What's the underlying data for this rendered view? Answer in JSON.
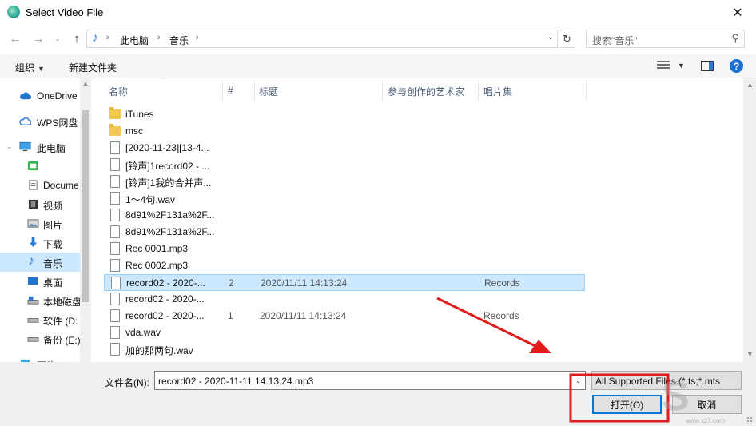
{
  "window": {
    "title": "Select Video File"
  },
  "address": {
    "crumbs": [
      "此电脑",
      "音乐"
    ],
    "search_placeholder": "搜索\"音乐\""
  },
  "toolbar": {
    "organize_label": "组织",
    "new_folder_label": "新建文件夹"
  },
  "nav": {
    "items": [
      {
        "label": "OneDrive",
        "icon": "cloud-icon"
      },
      {
        "label": "WPS网盘",
        "icon": "cloud-icon"
      },
      {
        "label": "此电脑",
        "icon": "computer-icon"
      },
      {
        "label": "",
        "icon": "app-icon"
      },
      {
        "label": "Docume",
        "icon": "documents-icon"
      },
      {
        "label": "视频",
        "icon": "video-icon"
      },
      {
        "label": "图片",
        "icon": "picture-icon"
      },
      {
        "label": "下载",
        "icon": "download-icon"
      },
      {
        "label": "音乐",
        "icon": "music-icon"
      },
      {
        "label": "桌面",
        "icon": "desktop-icon"
      },
      {
        "label": "本地磁盘",
        "icon": "drive-icon"
      },
      {
        "label": "软件 (D:",
        "icon": "drive-icon"
      },
      {
        "label": "备份 (E:)",
        "icon": "drive-icon"
      },
      {
        "label": "网络",
        "icon": "network-icon"
      }
    ]
  },
  "columns": {
    "name": "名称",
    "num": "#",
    "title": "标题",
    "artist": "参与创作的艺术家",
    "album": "唱片集"
  },
  "files": [
    {
      "name": "iTunes",
      "type": "folder",
      "num": "",
      "title": "",
      "album": ""
    },
    {
      "name": "msc",
      "type": "folder",
      "num": "",
      "title": "",
      "album": ""
    },
    {
      "name": "[2020-11-23][13-4...",
      "type": "file",
      "num": "",
      "title": "",
      "album": ""
    },
    {
      "name": "[铃声]1record02 - ...",
      "type": "file",
      "num": "",
      "title": "",
      "album": ""
    },
    {
      "name": "[铃声]1我的合并声...",
      "type": "file",
      "num": "",
      "title": "",
      "album": ""
    },
    {
      "name": "1～4句.wav",
      "type": "file",
      "num": "",
      "title": "",
      "album": ""
    },
    {
      "name": "8d91%2F131a%2F...",
      "type": "file",
      "num": "",
      "title": "",
      "album": ""
    },
    {
      "name": "8d91%2F131a%2F...",
      "type": "file",
      "num": "",
      "title": "",
      "album": ""
    },
    {
      "name": "Rec 0001.mp3",
      "type": "file",
      "num": "",
      "title": "",
      "album": ""
    },
    {
      "name": "Rec 0002.mp3",
      "type": "file",
      "num": "",
      "title": "",
      "album": ""
    },
    {
      "name": "record02 - 2020-...",
      "type": "file",
      "num": "2",
      "title": "2020/11/11 14:13:24",
      "album": "Records",
      "selected": true
    },
    {
      "name": "record02 - 2020-...",
      "type": "file",
      "num": "",
      "title": "",
      "album": ""
    },
    {
      "name": "record02 - 2020-...",
      "type": "file",
      "num": "1",
      "title": "2020/11/11 14:13:24",
      "album": "Records"
    },
    {
      "name": "vda.wav",
      "type": "file",
      "num": "",
      "title": "",
      "album": ""
    },
    {
      "name": "加的那两句.wav",
      "type": "file",
      "num": "",
      "title": "",
      "album": ""
    }
  ],
  "footer": {
    "filename_label": "文件名(N):",
    "filename_value": "record02 - 2020-11-11 14.13.24.mp3",
    "filter_value": "All Supported Files (*.ts;*.mts",
    "open_label": "打开(O)",
    "cancel_label": "取消"
  },
  "colors": {
    "selection": "#cce8ff",
    "accent": "#0078d7",
    "annotation": "#e01b1b"
  },
  "watermark": {
    "text": "S",
    "subtext": "www.xz7.com"
  }
}
